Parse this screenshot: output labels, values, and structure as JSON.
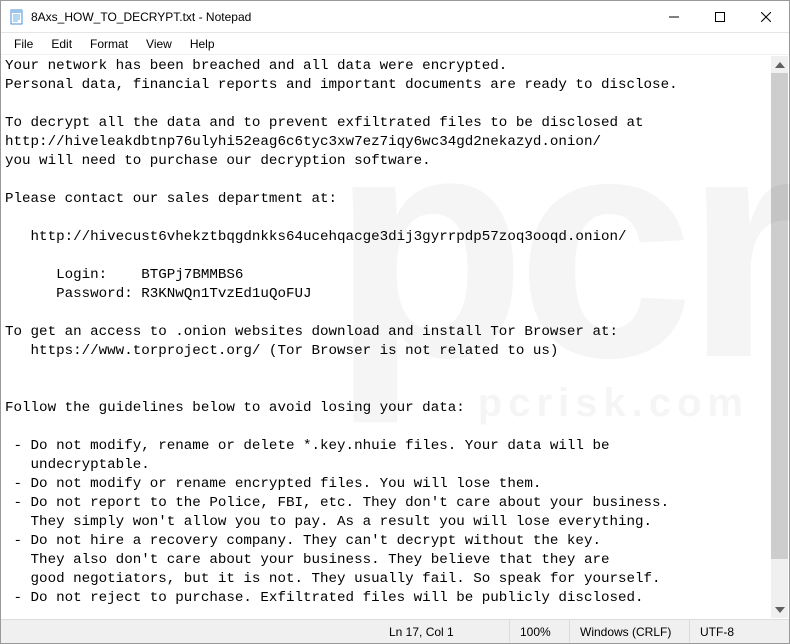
{
  "titlebar": {
    "title": "8Axs_HOW_TO_DECRYPT.txt - Notepad"
  },
  "menu": {
    "file": "File",
    "edit": "Edit",
    "format": "Format",
    "view": "View",
    "help": "Help"
  },
  "content": "Your network has been breached and all data were encrypted.\nPersonal data, financial reports and important documents are ready to disclose.\n\nTo decrypt all the data and to prevent exfiltrated files to be disclosed at \nhttp://hiveleakdbtnp76ulyhi52eag6c6tyc3xw7ez7iqy6wc34gd2nekazyd.onion/\nyou will need to purchase our decryption software.\n\nPlease contact our sales department at:\n\n   http://hivecust6vhekztbqgdnkks64ucehqacge3dij3gyrrpdp57zoq3ooqd.onion/\n\n      Login:    BTGPj7BMMBS6\n      Password: R3KNwQn1TvzEd1uQoFUJ\n\nTo get an access to .onion websites download and install Tor Browser at:\n   https://www.torproject.org/ (Tor Browser is not related to us)\n\n\nFollow the guidelines below to avoid losing your data:\n\n - Do not modify, rename or delete *.key.nhuie files. Your data will be \n   undecryptable.\n - Do not modify or rename encrypted files. You will lose them.\n - Do not report to the Police, FBI, etc. They don't care about your business.\n   They simply won't allow you to pay. As a result you will lose everything.\n - Do not hire a recovery company. They can't decrypt without the key. \n   They also don't care about your business. They believe that they are \n   good negotiators, but it is not. They usually fail. So speak for yourself.\n - Do not reject to purchase. Exfiltrated files will be publicly disclosed.",
  "statusbar": {
    "position": "Ln 17, Col 1",
    "zoom": "100%",
    "line_ending": "Windows (CRLF)",
    "encoding": "UTF-8"
  },
  "watermark": {
    "big": "pcr",
    "sub": "pcrisk.com"
  }
}
